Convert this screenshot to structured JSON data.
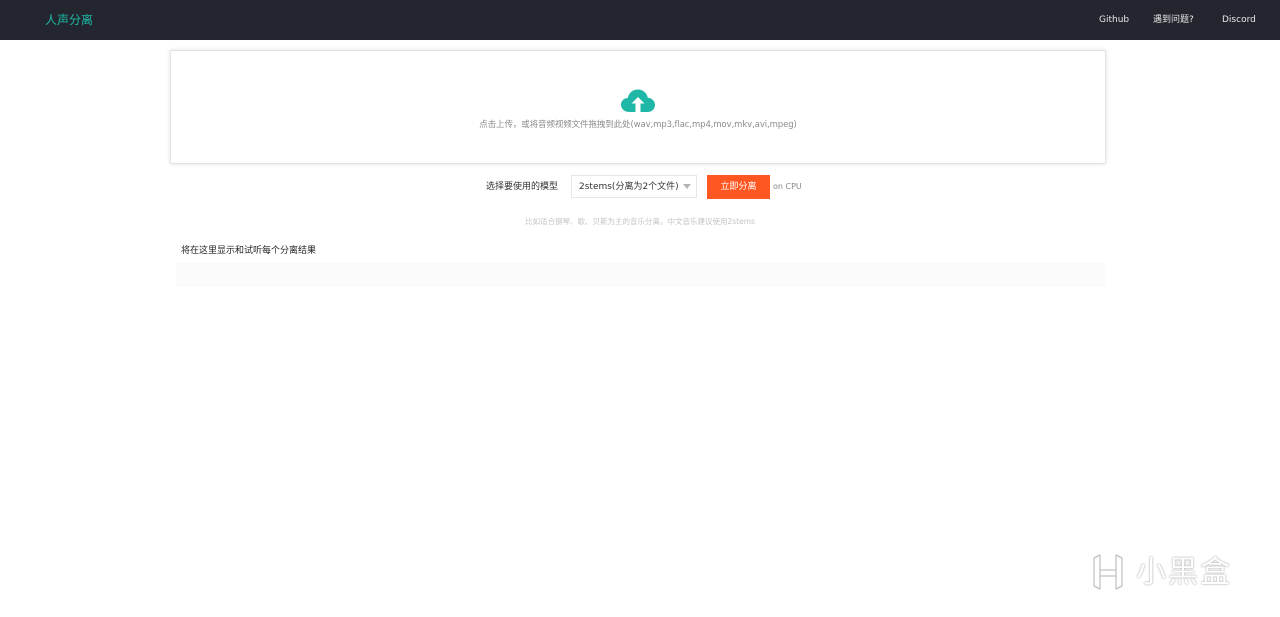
{
  "header": {
    "brand": "人声分离",
    "nav": {
      "github": "Github",
      "problem": "遇到问题?",
      "discord": "Discord"
    }
  },
  "upload": {
    "hint": "点击上传，或将音频视频文件拖拽到此处(wav,mp3,flac,mp4,mov,mkv,avi,mpeg)",
    "icon": "cloud-upload-icon",
    "icon_color": "#1fb8a6"
  },
  "model": {
    "label": "选择要使用的模型",
    "selected": "2stems(分离为2个文件)",
    "button": "立即分离",
    "button_color": "#ff5722",
    "device": "on CPU",
    "note": "比如适合钢琴、歌、贝斯为主的音乐分离，中文音乐建议使用2stems"
  },
  "results": {
    "title": "将在这里显示和试听每个分离结果"
  },
  "watermark": {
    "text": "小黑盒"
  }
}
